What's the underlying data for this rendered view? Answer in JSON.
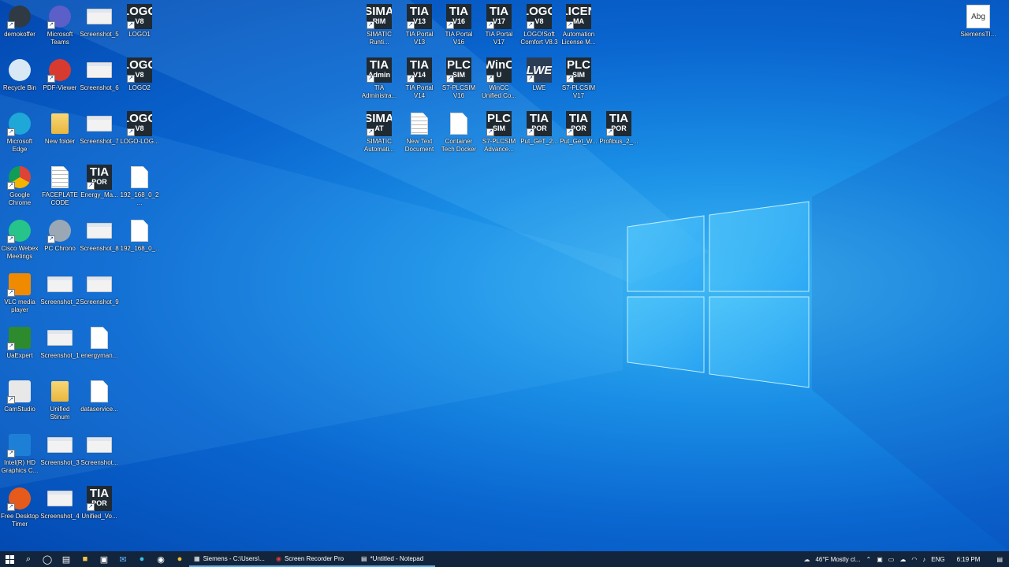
{
  "desktop": {
    "icons": [
      {
        "id": "demokoffer",
        "label": "demokoffer",
        "icon": "demokoffer-icon"
      },
      {
        "id": "teams",
        "label": "Microsoft Teams",
        "icon": "teams-icon"
      },
      {
        "id": "screenshot5",
        "label": "Screenshot_5",
        "icon": "image-file-icon"
      },
      {
        "id": "logo1",
        "label": "LOGO1",
        "icon": "logo-v8-icon",
        "tile": [
          "LOGO",
          "V8"
        ]
      },
      {
        "id": "recycle",
        "label": "Recycle Bin",
        "icon": "recycle-bin-icon"
      },
      {
        "id": "pdfviewer",
        "label": "PDF-Viewer",
        "icon": "pdf-icon"
      },
      {
        "id": "screenshot6",
        "label": "Screenshot_6",
        "icon": "image-file-icon"
      },
      {
        "id": "logo2",
        "label": "LOGO2",
        "icon": "logo-v8-icon",
        "tile": [
          "LOGO",
          "V8"
        ]
      },
      {
        "id": "edge",
        "label": "Microsoft Edge",
        "icon": "edge-icon"
      },
      {
        "id": "newfolder",
        "label": "New folder",
        "icon": "folder-icon"
      },
      {
        "id": "screenshot7",
        "label": "Screenshot_7",
        "icon": "image-file-icon"
      },
      {
        "id": "logolog",
        "label": "LOGO-LOG...",
        "icon": "logo-v8-icon",
        "tile": [
          "LOGO",
          "V8"
        ]
      },
      {
        "id": "chrome",
        "label": "Google Chrome",
        "icon": "chrome-icon"
      },
      {
        "id": "faceplate",
        "label": "FACEPLATE CODE",
        "icon": "text-file-icon"
      },
      {
        "id": "energyma",
        "label": "Energy_Ma...",
        "icon": "tia-portal-icon",
        "tile": [
          "TIA",
          "POR"
        ]
      },
      {
        "id": "ip1",
        "label": "192_168_0_2...",
        "icon": "blank-file-icon"
      },
      {
        "id": "webex",
        "label": "Cisco Webex Meetings",
        "icon": "webex-icon"
      },
      {
        "id": "pcchrono",
        "label": "PC Chrono",
        "icon": "clock-icon"
      },
      {
        "id": "screenshot8",
        "label": "Screenshot_8",
        "icon": "image-file-icon"
      },
      {
        "id": "ip2",
        "label": "192_168_0_...",
        "icon": "blank-file-icon"
      },
      {
        "id": "vlc",
        "label": "VLC media player",
        "icon": "vlc-icon"
      },
      {
        "id": "screenshot2",
        "label": "Screenshot_2",
        "icon": "image-file-icon"
      },
      {
        "id": "screenshot9",
        "label": "Screenshot_9",
        "icon": "image-file-icon"
      },
      {
        "id": "uaexpert",
        "label": "UaExpert",
        "icon": "uaexpert-icon"
      },
      {
        "id": "screenshot1",
        "label": "Screenshot_1",
        "icon": "image-file-icon"
      },
      {
        "id": "energyman",
        "label": "energyman...",
        "icon": "blank-file-icon"
      },
      {
        "id": "camstudio",
        "label": "CamStudio",
        "icon": "camstudio-icon"
      },
      {
        "id": "unified",
        "label": "Unified Stinum",
        "icon": "folder-icon"
      },
      {
        "id": "dataservice",
        "label": "dataservice...",
        "icon": "blank-file-icon"
      },
      {
        "id": "intelhd",
        "label": "Intel(R) HD Graphics C...",
        "icon": "intel-graphics-icon"
      },
      {
        "id": "screenshot3",
        "label": "Screenshot_3",
        "icon": "image-file-icon"
      },
      {
        "id": "screenshotx",
        "label": "Screenshot...",
        "icon": "image-file-icon"
      },
      {
        "id": "freetimer",
        "label": "Free Desktop Timer",
        "icon": "timer-icon"
      },
      {
        "id": "screenshot4",
        "label": "Screenshot_4",
        "icon": "image-file-icon"
      },
      {
        "id": "unifiedvo",
        "label": "Unified_Vo...",
        "icon": "tia-portal-icon",
        "tile": [
          "TIA",
          "POR"
        ]
      },
      {
        "id": "simaticrunti",
        "label": "SIMATIC Runti...",
        "icon": "simatic-icon",
        "tile": [
          "SIMA",
          "RIM"
        ]
      },
      {
        "id": "tiav13",
        "label": "TIA Portal V13",
        "icon": "tia-portal-icon",
        "tile": [
          "TIA",
          "V13"
        ]
      },
      {
        "id": "tiav16",
        "label": "TIA Portal V16",
        "icon": "tia-portal-icon",
        "tile": [
          "TIA",
          "V16"
        ]
      },
      {
        "id": "tiav17",
        "label": "TIA Portal V17",
        "icon": "tia-portal-icon",
        "tile": [
          "TIA",
          "V17"
        ]
      },
      {
        "id": "logosoft",
        "label": "LOGO!Soft Comfort V8.3",
        "icon": "logo-v8-icon",
        "tile": [
          "LOGO",
          "V8"
        ]
      },
      {
        "id": "automlicense",
        "label": "Automation License M...",
        "icon": "license-icon",
        "tile": [
          "LICEN",
          "MA"
        ]
      },
      {
        "id": "tiaadmin",
        "label": "TIA Administra...",
        "icon": "tia-admin-icon",
        "tile": [
          "TIA",
          "Admin"
        ]
      },
      {
        "id": "tiav14",
        "label": "TIA Portal V14",
        "icon": "tia-portal-icon",
        "tile": [
          "TIA",
          "V14"
        ]
      },
      {
        "id": "plcsimv16",
        "label": "S7-PLCSIM V16",
        "icon": "plcsim-icon",
        "tile": [
          "PLC",
          "SIM"
        ]
      },
      {
        "id": "wincc",
        "label": "WinCC Unified Co...",
        "icon": "wincc-icon",
        "tile": [
          "WinC",
          "U"
        ]
      },
      {
        "id": "lwe",
        "label": "LWE",
        "icon": "lwe-icon",
        "tile": [
          "LWE",
          ""
        ]
      },
      {
        "id": "plcsimv17",
        "label": "S7-PLCSIM V17",
        "icon": "plcsim-icon",
        "tile": [
          "PLC",
          "SIM"
        ]
      },
      {
        "id": "simaticautom",
        "label": "SIMATIC Automati...",
        "icon": "simatic-icon",
        "tile": [
          "SIMA",
          "AT"
        ]
      },
      {
        "id": "newtext",
        "label": "New Text Document",
        "icon": "text-file-icon"
      },
      {
        "id": "container",
        "label": "Container Tech Docker",
        "icon": "doc-file-icon"
      },
      {
        "id": "plcsimadv",
        "label": "S7-PLCSIM Advance...",
        "icon": "plcsim-icon",
        "tile": [
          "PLC",
          "SIM"
        ]
      },
      {
        "id": "putget2",
        "label": "Put_GeT_2...",
        "icon": "tia-portal-icon",
        "tile": [
          "TIA",
          "POR"
        ]
      },
      {
        "id": "putgetw",
        "label": "Put_Get_W...",
        "icon": "tia-portal-icon",
        "tile": [
          "TIA",
          "POR"
        ]
      },
      {
        "id": "profibus",
        "label": "Profibus_2_...",
        "icon": "tia-portal-icon",
        "tile": [
          "TIA",
          "POR"
        ]
      },
      {
        "id": "siemensti",
        "label": "SiemensTI...",
        "icon": "font-file-icon",
        "tile": [
          "Abg",
          ""
        ]
      }
    ]
  },
  "taskbar": {
    "apps": [
      {
        "label": "Siemens - C:\\Users\\...",
        "icon": "siemens-icon"
      },
      {
        "label": "Screen Recorder Pro",
        "icon": "record-icon"
      },
      {
        "label": "*Untitled - Notepad",
        "icon": "notepad-icon"
      }
    ],
    "weather": "46°F  Mostly cl...",
    "language": "ENG",
    "time": "6:19 PM"
  }
}
